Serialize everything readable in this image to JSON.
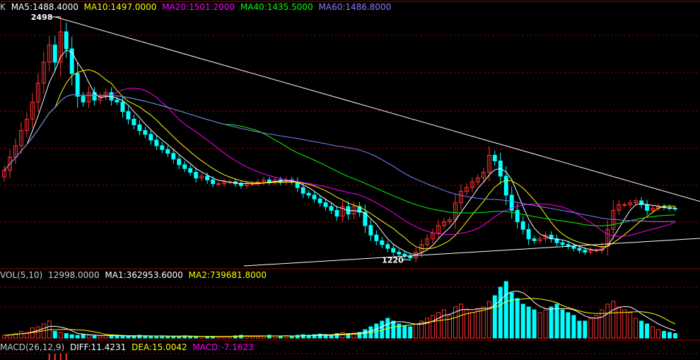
{
  "main_legend": {
    "prefix": "K",
    "ma5": "MA5:1488.4000",
    "ma10": "MA10:1497.0000",
    "ma20": "MA20:1501.2000",
    "ma40": "MA40:1435.5000",
    "ma60": "MA60:1486.8000"
  },
  "vol_legend": {
    "title": "VOL(5,10)",
    "value": "12998.0000",
    "ma1": "MA1:362953.6000",
    "ma2": "MA2:739681.8000"
  },
  "macd_legend": {
    "title": "MACD(26,12,9)",
    "diff": "DIFF:11.4231",
    "dea": "DEA:15.0042",
    "macd": "MACD:-7.1623"
  },
  "annotations": {
    "high": "2498",
    "low": "1220"
  },
  "colors": {
    "up": "#ff3232",
    "down": "#00ffff",
    "ma5": "#ffffff",
    "ma10": "#ffff00",
    "ma20": "#ff00ff",
    "ma40": "#00ff00",
    "ma60": "#8080ff",
    "grid": "#8b0000"
  },
  "chart_data": {
    "type": "candlestick",
    "panels": [
      "price",
      "volume",
      "macd"
    ],
    "price_range_visible": [
      1180,
      2520
    ],
    "highest": 2498,
    "lowest": 1220,
    "closes": [
      1690,
      1760,
      1820,
      1900,
      1960,
      2050,
      2150,
      2260,
      2350,
      2260,
      2420,
      2330,
      2200,
      2080,
      2050,
      2100,
      2060,
      2080,
      2100,
      2060,
      2050,
      2000,
      1960,
      1930,
      1900,
      1880,
      1850,
      1820,
      1800,
      1780,
      1750,
      1720,
      1700,
      1680,
      1650,
      1660,
      1640,
      1620,
      1620,
      1630,
      1630,
      1620,
      1610,
      1620,
      1620,
      1630,
      1640,
      1630,
      1640,
      1630,
      1640,
      1630,
      1600,
      1570,
      1560,
      1540,
      1520,
      1500,
      1480,
      1450,
      1500,
      1460,
      1500,
      1470,
      1400,
      1350,
      1320,
      1300,
      1280,
      1260,
      1250,
      1240,
      1230,
      1260,
      1300,
      1330,
      1360,
      1400,
      1420,
      1430,
      1520,
      1580,
      1600,
      1630,
      1650,
      1680,
      1770,
      1740,
      1660,
      1560,
      1480,
      1420,
      1380,
      1330,
      1320,
      1330,
      1350,
      1330,
      1310,
      1300,
      1290,
      1280,
      1270,
      1260,
      1270,
      1270,
      1290,
      1380,
      1480,
      1510,
      1510,
      1520,
      1530,
      1510,
      1480,
      1490,
      1500,
      1495,
      1490,
      1488
    ],
    "volume_max_relative": 1.0,
    "volume_relative": [
      0.05,
      0.06,
      0.08,
      0.12,
      0.1,
      0.18,
      0.2,
      0.25,
      0.3,
      0.12,
      0.1,
      0.08,
      0.06,
      0.05,
      0.06,
      0.05,
      0.04,
      0.04,
      0.05,
      0.04,
      0.04,
      0.03,
      0.03,
      0.04,
      0.05,
      0.04,
      0.03,
      0.03,
      0.04,
      0.03,
      0.03,
      0.03,
      0.04,
      0.03,
      0.02,
      0.03,
      0.03,
      0.02,
      0.03,
      0.03,
      0.03,
      0.04,
      0.05,
      0.04,
      0.03,
      0.03,
      0.04,
      0.05,
      0.04,
      0.03,
      0.04,
      0.03,
      0.05,
      0.06,
      0.05,
      0.06,
      0.07,
      0.06,
      0.05,
      0.08,
      0.1,
      0.08,
      0.09,
      0.1,
      0.15,
      0.2,
      0.25,
      0.3,
      0.35,
      0.3,
      0.25,
      0.22,
      0.2,
      0.25,
      0.3,
      0.35,
      0.4,
      0.45,
      0.5,
      0.4,
      0.55,
      0.6,
      0.5,
      0.45,
      0.5,
      0.55,
      0.65,
      0.75,
      0.9,
      1.0,
      0.8,
      0.7,
      0.6,
      0.55,
      0.5,
      0.45,
      0.5,
      0.55,
      0.6,
      0.5,
      0.45,
      0.4,
      0.3,
      0.3,
      0.35,
      0.4,
      0.5,
      0.6,
      0.65,
      0.55,
      0.5,
      0.45,
      0.35,
      0.3,
      0.25,
      0.2,
      0.15,
      0.12,
      0.1,
      0.08
    ]
  }
}
